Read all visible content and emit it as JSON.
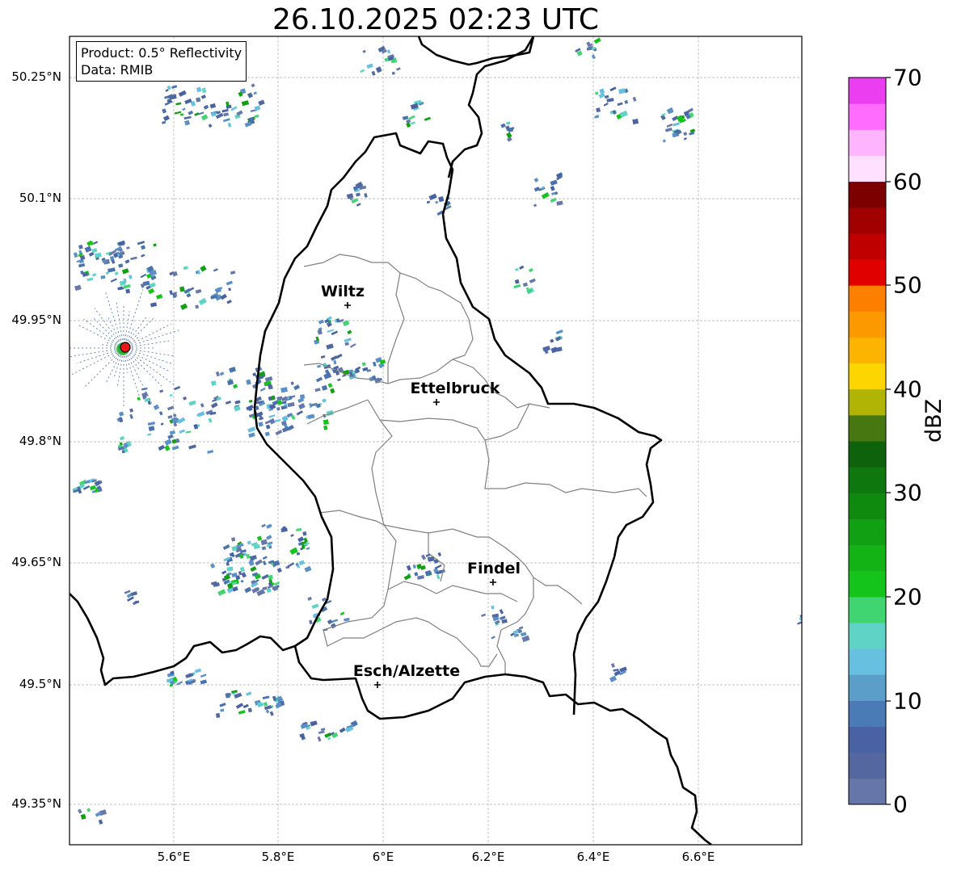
{
  "title": "26.10.2025 02:23 UTC",
  "info": {
    "product": "Product: 0.5° Reflectivity",
    "data_source": "Data: RMIB"
  },
  "axes": {
    "lat_ticks": [
      "50.25°N",
      "50.1°N",
      "49.95°N",
      "49.8°N",
      "49.65°N",
      "49.5°N",
      "49.35°N"
    ],
    "lon_ticks": [
      "5.6°E",
      "5.8°E",
      "6°E",
      "6.2°E",
      "6.4°E",
      "6.6°E"
    ],
    "grid": true
  },
  "cities": [
    {
      "name": "Wiltz"
    },
    {
      "name": "Ettelbruck"
    },
    {
      "name": "Findel"
    },
    {
      "name": "Esch/Alzette"
    }
  ],
  "colorbar": {
    "label": "dBZ",
    "ticks": [
      "0",
      "10",
      "20",
      "30",
      "40",
      "50",
      "60",
      "70"
    ],
    "colors": [
      "#6776a9",
      "#54689f",
      "#4862a3",
      "#4a7bb7",
      "#5a9ec9",
      "#67c0df",
      "#5fd3c5",
      "#41d571",
      "#14c41a",
      "#13b316",
      "#119f13",
      "#10890f",
      "#0e770d",
      "#0d620b",
      "#467710",
      "#b1b305",
      "#fdd601",
      "#fdb400",
      "#fd9900",
      "#fd7f00",
      "#e00000",
      "#c00000",
      "#a00000",
      "#7d0000",
      "#ffe0fe",
      "#ffb4fe",
      "#ff6cfe",
      "#ea3ef0"
    ]
  },
  "radar_site_color": "#e8171b"
}
